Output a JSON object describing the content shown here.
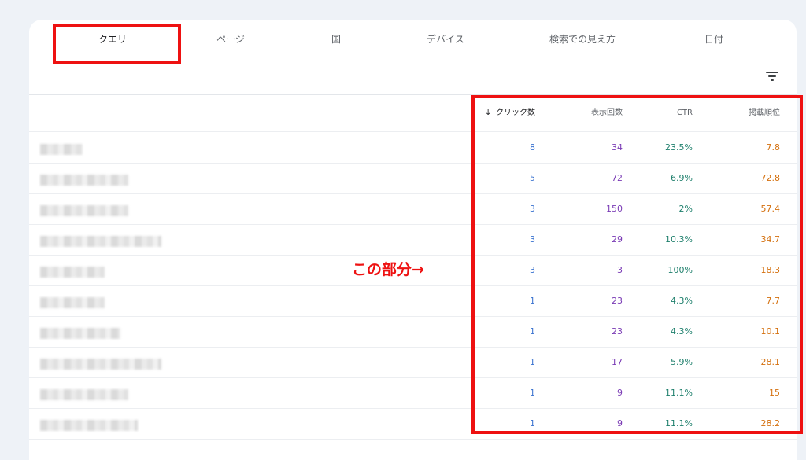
{
  "tabs": [
    {
      "label": "クエリ"
    },
    {
      "label": "ページ"
    },
    {
      "label": "国"
    },
    {
      "label": "デバイス"
    },
    {
      "label": "検索での見え方"
    },
    {
      "label": "日付"
    }
  ],
  "filter_icon": "filter-list-icon",
  "sort_icon": "arrow-down-icon",
  "table": {
    "headers": {
      "clicks": "クリック数",
      "impressions": "表示回数",
      "ctr": "CTR",
      "position": "掲載順位"
    },
    "rows": [
      {
        "clicks": "8",
        "impressions": "34",
        "ctr": "23.5%",
        "position": "7.8"
      },
      {
        "clicks": "5",
        "impressions": "72",
        "ctr": "6.9%",
        "position": "72.8"
      },
      {
        "clicks": "3",
        "impressions": "150",
        "ctr": "2%",
        "position": "57.4"
      },
      {
        "clicks": "3",
        "impressions": "29",
        "ctr": "10.3%",
        "position": "34.7"
      },
      {
        "clicks": "3",
        "impressions": "3",
        "ctr": "100%",
        "position": "18.3"
      },
      {
        "clicks": "1",
        "impressions": "23",
        "ctr": "4.3%",
        "position": "7.7"
      },
      {
        "clicks": "1",
        "impressions": "23",
        "ctr": "4.3%",
        "position": "10.1"
      },
      {
        "clicks": "1",
        "impressions": "17",
        "ctr": "5.9%",
        "position": "28.1"
      },
      {
        "clicks": "1",
        "impressions": "9",
        "ctr": "11.1%",
        "position": "15"
      },
      {
        "clicks": "1",
        "impressions": "9",
        "ctr": "11.1%",
        "position": "28.2"
      }
    ]
  },
  "annotation": "この部分→",
  "colors": {
    "clicks": "#3c74d0",
    "impressions": "#7a3bb5",
    "ctr": "#1e7f6c",
    "position": "#d4700e",
    "highlight": "#ee1111"
  }
}
